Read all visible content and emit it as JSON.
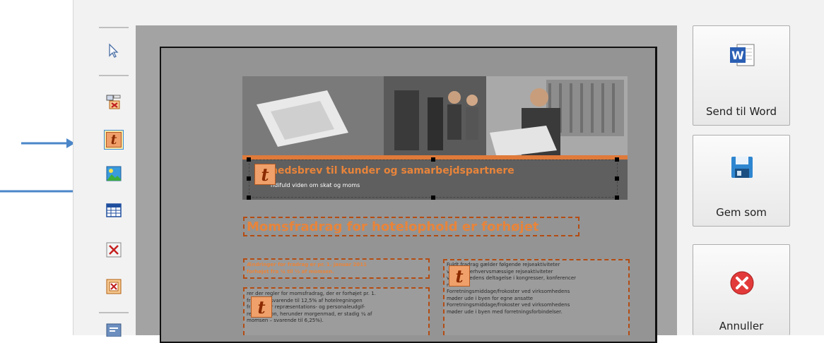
{
  "colors": {
    "accent_orange": "#e8843a",
    "dashed_border": "#b44c12",
    "selection_highlight": "#fde9a6",
    "arrow_blue": "#4a86c8"
  },
  "toolbar": {
    "items": [
      {
        "name": "pointer-tool",
        "icon": "cursor-arrow-icon"
      },
      {
        "name": "delete-picture-tool",
        "icon": "delete-picture-icon"
      },
      {
        "name": "text-box-tool",
        "icon": "text-t-icon",
        "selected": true
      },
      {
        "name": "picture-tool",
        "icon": "picture-icon"
      },
      {
        "name": "table-tool",
        "icon": "table-icon"
      },
      {
        "name": "delete-tool",
        "icon": "delete-x-icon"
      },
      {
        "name": "delete-text-tool",
        "icon": "delete-text-icon"
      },
      {
        "name": "extra-tool",
        "icon": "tool-icon"
      }
    ]
  },
  "document": {
    "header_title": "hedsbrev til kunder og samarbejdspartnere",
    "header_subtitle": "ndifuld viden om skat og moms",
    "headline": "Momsfradrag for hotelophold er forhøjet",
    "left_intro": "Ændringer for fradrag er pr. 1. januar 2011\nforhøjet fra ¼ til ½ af momsen.",
    "left_body": "rer der regler for momsfradrag, der er forhøjet pr. 1.\nfradrag – svarende til 12,5% af hotelregningen\nfradrag for repræsentations- og personaleudgif-\nrestauration, herunder morgenmad, er stadig ¼ af\nmomsen – svarende til 6,25%).",
    "right_body": "Fuldt fradrag gælder følgende rejseaktiviteter\nvarernes erhvervsmæssige rejseaktiviteter\nvirksomhedens deltagelse i kongresser, konferencer\nm.v.\nForretningsmiddage/frokoster ved virksomhedens\nmøder ude i byen for egne ansatte\nForretningsmiddage/frokoster ved virksomhedens\nmøder ude i byen med forretningsforbindelser."
  },
  "buttons": {
    "send_to_word": "Send til Word",
    "save_as": "Gem som",
    "cancel": "Annuller"
  }
}
